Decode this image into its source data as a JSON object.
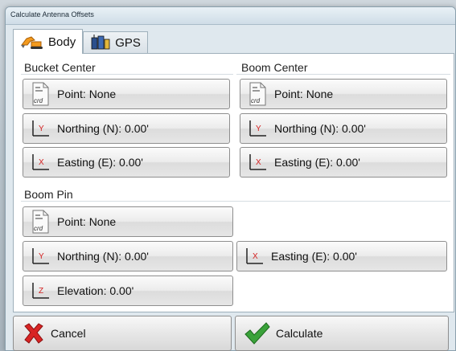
{
  "window": {
    "title": "Calculate Antenna Offsets"
  },
  "tabs": [
    {
      "label": "Body",
      "icon": "excavator-icon",
      "active": true
    },
    {
      "label": "GPS",
      "icon": "gps-receiver-icon",
      "active": false
    }
  ],
  "bucket_center": {
    "title": "Bucket Center",
    "point": "Point: None",
    "northing": "Northing (N): 0.00'",
    "easting": "Easting (E): 0.00'"
  },
  "boom_center": {
    "title": "Boom Center",
    "point": "Point: None",
    "northing": "Northing (N): 0.00'",
    "easting": "Easting (E): 0.00'"
  },
  "boom_pin": {
    "title": "Boom Pin",
    "point": "Point: None",
    "northing": "Northing (N): 0.00'",
    "easting": "Easting (E): 0.00'",
    "elevation": "Elevation: 0.00'"
  },
  "icon_labels": {
    "crd": "crd",
    "y": "Y",
    "x": "X",
    "z": "Z"
  },
  "actions": {
    "cancel": "Cancel",
    "calculate": "Calculate"
  },
  "colors": {
    "axis_red": "#d42020",
    "check_green": "#3aa23a",
    "cancel_red": "#d82424"
  }
}
